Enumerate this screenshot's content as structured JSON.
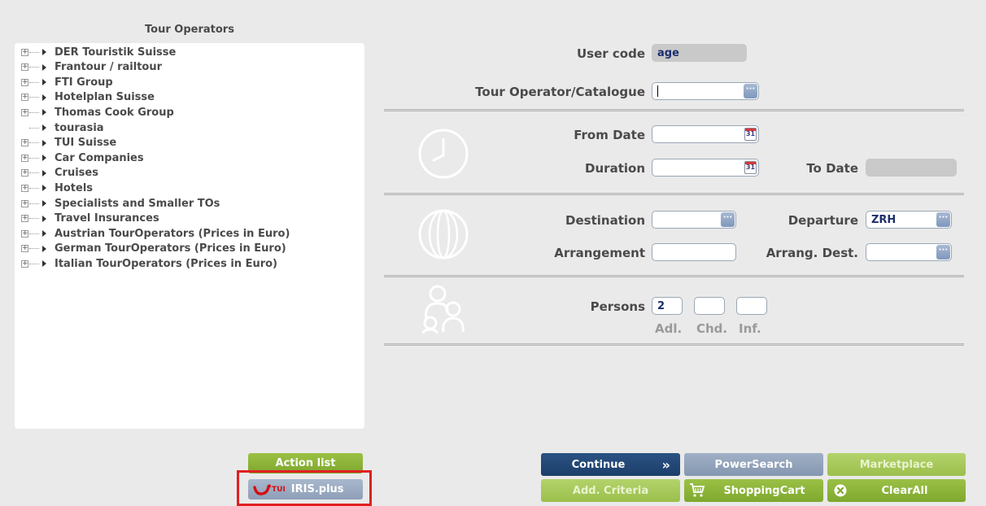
{
  "tour_operators": {
    "title": "Tour Operators",
    "items": [
      {
        "label": "DER Touristik Suisse",
        "expandable": true
      },
      {
        "label": "Frantour / railtour",
        "expandable": true
      },
      {
        "label": "FTI Group",
        "expandable": true
      },
      {
        "label": "Hotelplan Suisse",
        "expandable": true
      },
      {
        "label": "Thomas Cook Group",
        "expandable": true
      },
      {
        "label": "tourasia",
        "expandable": false
      },
      {
        "label": "TUI Suisse",
        "expandable": true
      },
      {
        "label": "Car Companies",
        "expandable": true
      },
      {
        "label": "Cruises",
        "expandable": true
      },
      {
        "label": "Hotels",
        "expandable": true
      },
      {
        "label": "Specialists and Smaller TOs",
        "expandable": true
      },
      {
        "label": "Travel Insurances",
        "expandable": true
      },
      {
        "label": "Austrian TourOperators (Prices in Euro)",
        "expandable": true
      },
      {
        "label": "German TourOperators (Prices in Euro)",
        "expandable": true
      },
      {
        "label": "Italian TourOperators (Prices in Euro)",
        "expandable": true
      }
    ]
  },
  "left_buttons": {
    "action_list": "Action list",
    "iris_logo": "TUI",
    "iris_label": "IRIS.plus"
  },
  "form": {
    "user_code_label": "User code",
    "user_code_value": "age",
    "tour_operator_label": "Tour Operator/Catalogue",
    "tour_operator_value": "",
    "from_date_label": "From Date",
    "from_date_value": "",
    "duration_label": "Duration",
    "duration_value": "",
    "to_date_label": "To Date",
    "to_date_value": "",
    "destination_label": "Destination",
    "destination_value": "",
    "departure_label": "Departure",
    "departure_value": "ZRH",
    "arrangement_label": "Arrangement",
    "arrangement_value": "",
    "arrang_dest_label": "Arrang. Dest.",
    "arrang_dest_value": "",
    "persons_label": "Persons",
    "adults_value": "2",
    "children_value": "",
    "infants_value": "",
    "adults_label": "Adl.",
    "children_label": "Chd.",
    "infants_label": "Inf.",
    "dropdown_glyph": "···",
    "calendar_glyph": "31"
  },
  "bottom_buttons": {
    "continue": "Continue",
    "continue_glyph": "»",
    "powersearch": "PowerSearch",
    "marketplace": "Marketplace",
    "add_criteria": "Add. Criteria",
    "shopping_cart": "ShoppingCart",
    "clear_all": "ClearAll"
  },
  "colors": {
    "green": "#8db43a",
    "navy": "#1f4473",
    "gray_blue": "#92a3bb",
    "red_frame": "#e02020",
    "tui_red": "#d40e14"
  }
}
